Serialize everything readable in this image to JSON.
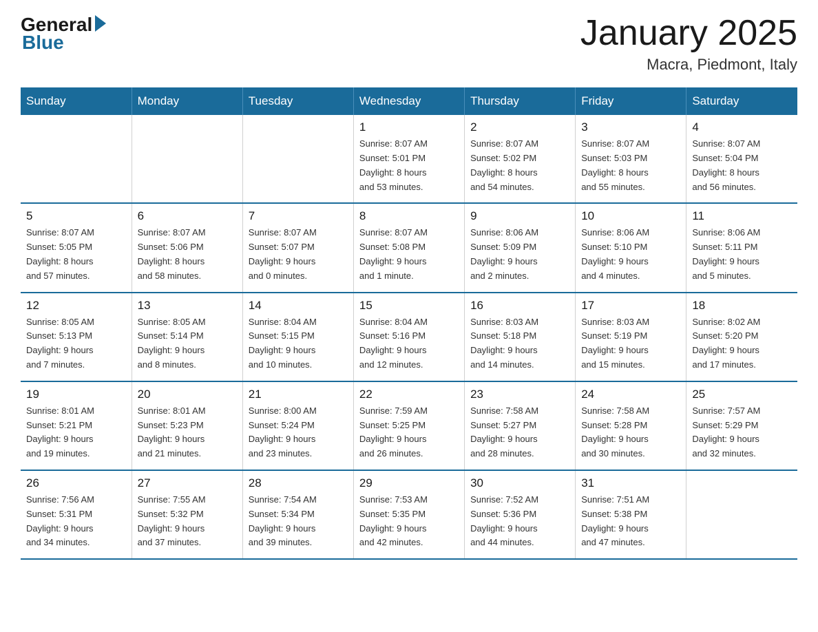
{
  "header": {
    "logo": {
      "general": "General",
      "blue": "Blue"
    },
    "title": "January 2025",
    "location": "Macra, Piedmont, Italy"
  },
  "calendar": {
    "days_of_week": [
      "Sunday",
      "Monday",
      "Tuesday",
      "Wednesday",
      "Thursday",
      "Friday",
      "Saturday"
    ],
    "weeks": [
      [
        {
          "day": "",
          "info": ""
        },
        {
          "day": "",
          "info": ""
        },
        {
          "day": "",
          "info": ""
        },
        {
          "day": "1",
          "info": "Sunrise: 8:07 AM\nSunset: 5:01 PM\nDaylight: 8 hours\nand 53 minutes."
        },
        {
          "day": "2",
          "info": "Sunrise: 8:07 AM\nSunset: 5:02 PM\nDaylight: 8 hours\nand 54 minutes."
        },
        {
          "day": "3",
          "info": "Sunrise: 8:07 AM\nSunset: 5:03 PM\nDaylight: 8 hours\nand 55 minutes."
        },
        {
          "day": "4",
          "info": "Sunrise: 8:07 AM\nSunset: 5:04 PM\nDaylight: 8 hours\nand 56 minutes."
        }
      ],
      [
        {
          "day": "5",
          "info": "Sunrise: 8:07 AM\nSunset: 5:05 PM\nDaylight: 8 hours\nand 57 minutes."
        },
        {
          "day": "6",
          "info": "Sunrise: 8:07 AM\nSunset: 5:06 PM\nDaylight: 8 hours\nand 58 minutes."
        },
        {
          "day": "7",
          "info": "Sunrise: 8:07 AM\nSunset: 5:07 PM\nDaylight: 9 hours\nand 0 minutes."
        },
        {
          "day": "8",
          "info": "Sunrise: 8:07 AM\nSunset: 5:08 PM\nDaylight: 9 hours\nand 1 minute."
        },
        {
          "day": "9",
          "info": "Sunrise: 8:06 AM\nSunset: 5:09 PM\nDaylight: 9 hours\nand 2 minutes."
        },
        {
          "day": "10",
          "info": "Sunrise: 8:06 AM\nSunset: 5:10 PM\nDaylight: 9 hours\nand 4 minutes."
        },
        {
          "day": "11",
          "info": "Sunrise: 8:06 AM\nSunset: 5:11 PM\nDaylight: 9 hours\nand 5 minutes."
        }
      ],
      [
        {
          "day": "12",
          "info": "Sunrise: 8:05 AM\nSunset: 5:13 PM\nDaylight: 9 hours\nand 7 minutes."
        },
        {
          "day": "13",
          "info": "Sunrise: 8:05 AM\nSunset: 5:14 PM\nDaylight: 9 hours\nand 8 minutes."
        },
        {
          "day": "14",
          "info": "Sunrise: 8:04 AM\nSunset: 5:15 PM\nDaylight: 9 hours\nand 10 minutes."
        },
        {
          "day": "15",
          "info": "Sunrise: 8:04 AM\nSunset: 5:16 PM\nDaylight: 9 hours\nand 12 minutes."
        },
        {
          "day": "16",
          "info": "Sunrise: 8:03 AM\nSunset: 5:18 PM\nDaylight: 9 hours\nand 14 minutes."
        },
        {
          "day": "17",
          "info": "Sunrise: 8:03 AM\nSunset: 5:19 PM\nDaylight: 9 hours\nand 15 minutes."
        },
        {
          "day": "18",
          "info": "Sunrise: 8:02 AM\nSunset: 5:20 PM\nDaylight: 9 hours\nand 17 minutes."
        }
      ],
      [
        {
          "day": "19",
          "info": "Sunrise: 8:01 AM\nSunset: 5:21 PM\nDaylight: 9 hours\nand 19 minutes."
        },
        {
          "day": "20",
          "info": "Sunrise: 8:01 AM\nSunset: 5:23 PM\nDaylight: 9 hours\nand 21 minutes."
        },
        {
          "day": "21",
          "info": "Sunrise: 8:00 AM\nSunset: 5:24 PM\nDaylight: 9 hours\nand 23 minutes."
        },
        {
          "day": "22",
          "info": "Sunrise: 7:59 AM\nSunset: 5:25 PM\nDaylight: 9 hours\nand 26 minutes."
        },
        {
          "day": "23",
          "info": "Sunrise: 7:58 AM\nSunset: 5:27 PM\nDaylight: 9 hours\nand 28 minutes."
        },
        {
          "day": "24",
          "info": "Sunrise: 7:58 AM\nSunset: 5:28 PM\nDaylight: 9 hours\nand 30 minutes."
        },
        {
          "day": "25",
          "info": "Sunrise: 7:57 AM\nSunset: 5:29 PM\nDaylight: 9 hours\nand 32 minutes."
        }
      ],
      [
        {
          "day": "26",
          "info": "Sunrise: 7:56 AM\nSunset: 5:31 PM\nDaylight: 9 hours\nand 34 minutes."
        },
        {
          "day": "27",
          "info": "Sunrise: 7:55 AM\nSunset: 5:32 PM\nDaylight: 9 hours\nand 37 minutes."
        },
        {
          "day": "28",
          "info": "Sunrise: 7:54 AM\nSunset: 5:34 PM\nDaylight: 9 hours\nand 39 minutes."
        },
        {
          "day": "29",
          "info": "Sunrise: 7:53 AM\nSunset: 5:35 PM\nDaylight: 9 hours\nand 42 minutes."
        },
        {
          "day": "30",
          "info": "Sunrise: 7:52 AM\nSunset: 5:36 PM\nDaylight: 9 hours\nand 44 minutes."
        },
        {
          "day": "31",
          "info": "Sunrise: 7:51 AM\nSunset: 5:38 PM\nDaylight: 9 hours\nand 47 minutes."
        },
        {
          "day": "",
          "info": ""
        }
      ]
    ]
  }
}
